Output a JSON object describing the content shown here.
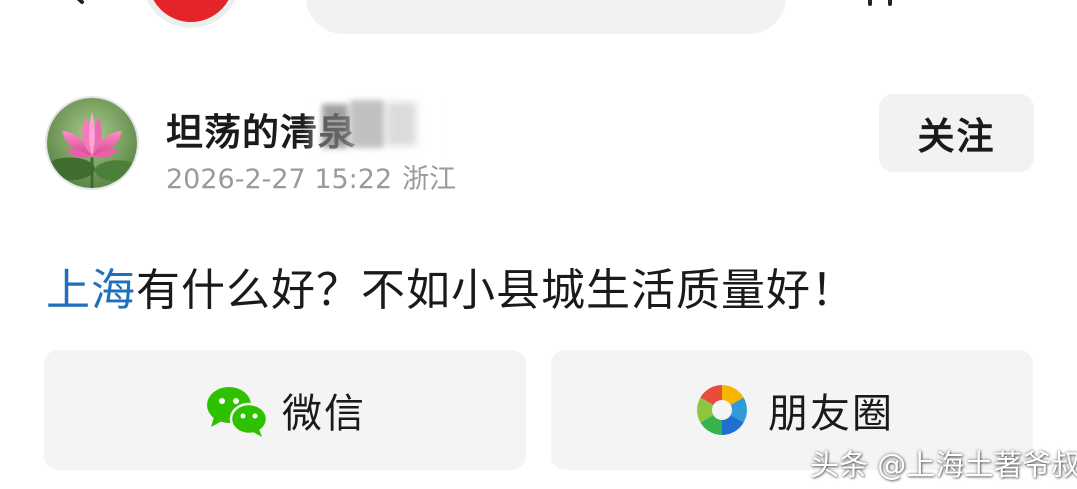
{
  "header": {
    "back_icon": "chevron-left-icon",
    "right_icon": "share-icon"
  },
  "author": {
    "name": "坦荡的清泉",
    "date": "2026-2-27 15:22",
    "location": "浙江",
    "avatar_icon": "lotus-avatar",
    "follow_label": "关注"
  },
  "post": {
    "topic": "上海",
    "text": "有什么好？不如小县城生活质量好！",
    "topic_color": "#1f6fbd"
  },
  "share": {
    "wechat_label": "微信",
    "moments_label": "朋友圈",
    "wechat_icon": "wechat-icon",
    "moments_icon": "moments-icon",
    "wechat_color": "#2dc100"
  },
  "watermark": "头条 @上海土著爷叔",
  "colors": {
    "accent_red": "#e5232b",
    "button_bg": "#f2f2f2",
    "meta_gray": "#9a9a9a"
  }
}
